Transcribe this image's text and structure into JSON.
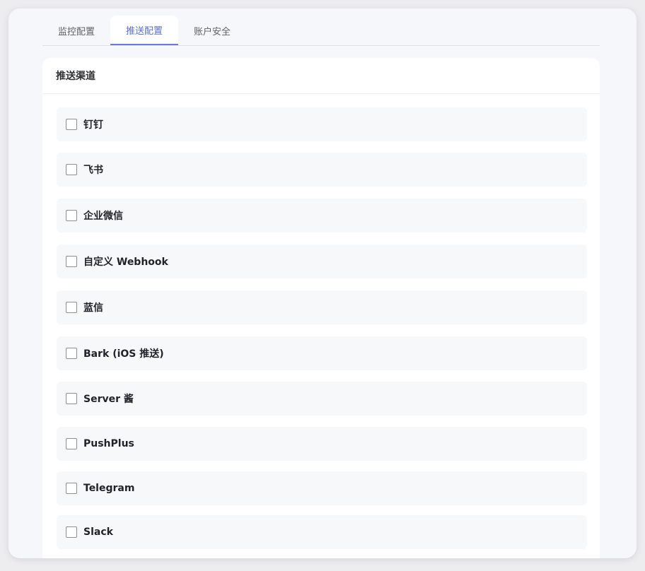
{
  "tabs": [
    {
      "label": "监控配置",
      "active": false
    },
    {
      "label": "推送配置",
      "active": true
    },
    {
      "label": "账户安全",
      "active": false
    }
  ],
  "card": {
    "title": "推送渠道"
  },
  "channels": [
    {
      "label": "钉钉",
      "checked": false
    },
    {
      "label": "飞书",
      "checked": false
    },
    {
      "label": "企业微信",
      "checked": false
    },
    {
      "label": "自定义 Webhook",
      "checked": false
    },
    {
      "label": "蓝信",
      "checked": false
    },
    {
      "label": "Bark (iOS 推送)",
      "checked": false
    },
    {
      "label": "Server 酱",
      "checked": false
    },
    {
      "label": "PushPlus",
      "checked": false
    },
    {
      "label": "Telegram",
      "checked": false
    },
    {
      "label": "Slack",
      "checked": false
    }
  ],
  "colors": {
    "accent": "#5b6ed6",
    "window_bg": "#f6f7fa",
    "item_bg": "#f7f8fa"
  }
}
